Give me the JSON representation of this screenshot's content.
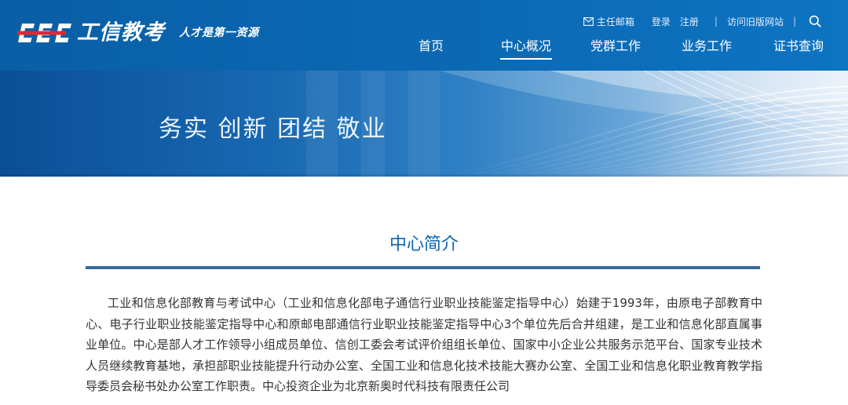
{
  "header": {
    "logo_text": "CEC",
    "site_name": "工信教考",
    "slogan": "人才是第一资源",
    "top_links": {
      "mail": "主任邮箱",
      "login": "登录",
      "register": "注册",
      "separator": "|",
      "old_site": "访问旧版网站"
    },
    "nav": [
      {
        "label": "首页"
      },
      {
        "label": "中心概况",
        "active": true
      },
      {
        "label": "党群工作"
      },
      {
        "label": "业务工作"
      },
      {
        "label": "证书查询"
      }
    ]
  },
  "banner": {
    "motto": "务实 创新 团结 敬业"
  },
  "main": {
    "section_title": "中心简介",
    "intro": "工业和信息化部教育与考试中心（工业和信息化部电子通信行业职业技能鉴定指导中心）始建于1993年，由原电子部教育中心、电子行业职业技能鉴定指导中心和原邮电部通信行业职业技能鉴定指导中心3个单位先后合并组建，是工业和信息化部直属事业单位。中心是部人才工作领导小组成员单位、信创工委会考试评价组组长单位、国家中小企业公共服务示范平台、国家专业技术人员继续教育基地，承担部职业技能提升行动办公室、全国工业和信息化技术技能大赛办公室、全国工业和信息化职业教育教学指导委员会秘书处办公室工作职责。中心投资企业为北京新奥时代科技有限责任公司"
  },
  "colors": {
    "header_bg": "#0b69b4",
    "logo_accent": "#e0282e",
    "title_blue": "#0d64ae",
    "rule": "#3c6a9c",
    "body_text": "#333333"
  },
  "icons": {
    "mail": "mail-icon",
    "search": "search-icon"
  }
}
